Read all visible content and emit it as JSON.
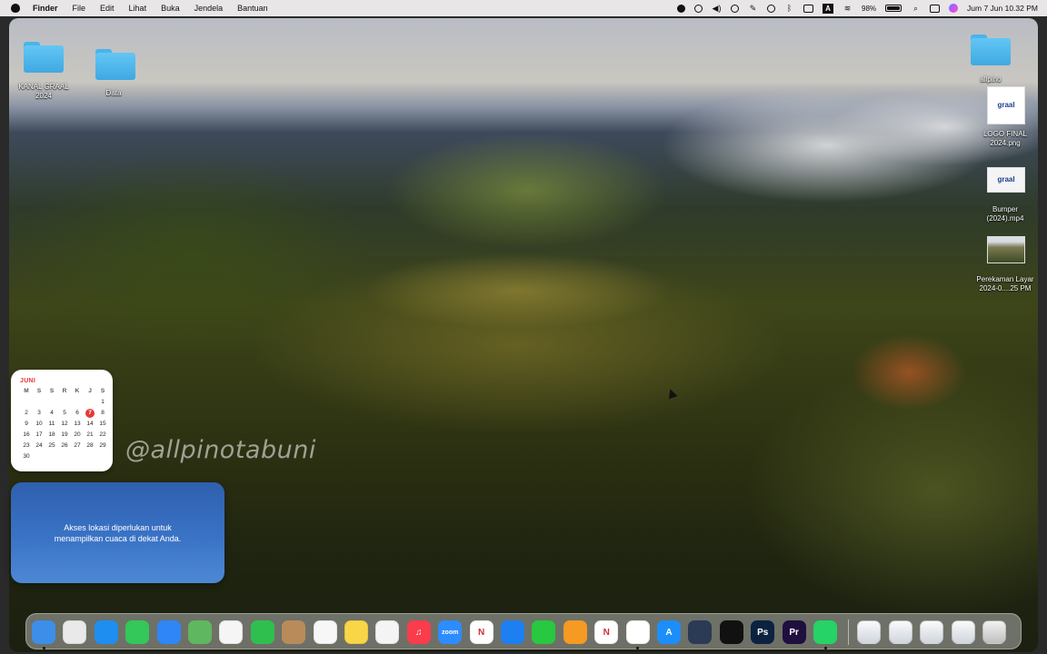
{
  "menubar": {
    "app_name": "Finder",
    "menus": [
      "File",
      "Edit",
      "Lihat",
      "Buka",
      "Jendela",
      "Bantuan"
    ],
    "battery": "98%",
    "datetime": "Jum 7 Jun  10.32 PM",
    "input_source": "A"
  },
  "desktop": {
    "left_icons": [
      {
        "label": "KANAL GRAAL\n2024",
        "icon": "folder-icon"
      },
      {
        "label": "Data",
        "icon": "folder-icon"
      }
    ],
    "right_icons": [
      {
        "label": "allpino",
        "icon": "folder-icon"
      },
      {
        "label": "LOGO FINAL\n2024.png",
        "icon": "image-file-icon",
        "thumb_text": "graal"
      },
      {
        "label": "Bumper\n(2024).mp4",
        "icon": "video-file-icon",
        "thumb_text": "graal"
      },
      {
        "label": "Perekaman Layar\n2024-0....25 PM",
        "icon": "screen-recording-icon"
      }
    ]
  },
  "calendar_widget": {
    "month": "JUNI",
    "weekdays": [
      "M",
      "S",
      "S",
      "R",
      "K",
      "J",
      "S"
    ],
    "weeks": [
      [
        "",
        "",
        "",
        "",
        "",
        "",
        "1"
      ],
      [
        "2",
        "3",
        "4",
        "5",
        "6",
        "7",
        "8"
      ],
      [
        "9",
        "10",
        "11",
        "12",
        "13",
        "14",
        "15"
      ],
      [
        "16",
        "17",
        "18",
        "19",
        "20",
        "21",
        "22"
      ],
      [
        "23",
        "24",
        "25",
        "26",
        "27",
        "28",
        "29"
      ],
      [
        "30",
        "",
        "",
        "",
        "",
        "",
        ""
      ]
    ],
    "today": "7",
    "accent_color": "#e53935"
  },
  "weather_widget": {
    "message": "Akses lokasi diperlukan untuk menampilkan cuaca di dekat Anda."
  },
  "watermark": "@allpinotabuni",
  "dock": {
    "apps": [
      {
        "name": "finder-icon",
        "color": "#3d8ee8",
        "glyph": "",
        "running": true
      },
      {
        "name": "launchpad-icon",
        "color": "#e9e9e9",
        "glyph": "",
        "running": false
      },
      {
        "name": "safari-icon",
        "color": "#1e8ef0",
        "glyph": "",
        "running": false
      },
      {
        "name": "messages-icon",
        "color": "#34c759",
        "glyph": "",
        "running": false
      },
      {
        "name": "mail-icon",
        "color": "#2f86f6",
        "glyph": "",
        "running": false
      },
      {
        "name": "maps-icon",
        "color": "#5fb85f",
        "glyph": "",
        "running": false
      },
      {
        "name": "photos-icon",
        "color": "#f5f5f5",
        "glyph": "",
        "running": false
      },
      {
        "name": "facetime-icon",
        "color": "#2fbf4f",
        "glyph": "",
        "running": false
      },
      {
        "name": "contacts-icon",
        "color": "#b98b5a",
        "glyph": "",
        "running": false
      },
      {
        "name": "reminders-icon",
        "color": "#f7f7f7",
        "glyph": "",
        "running": false
      },
      {
        "name": "notes-icon",
        "color": "#f9d648",
        "glyph": "",
        "running": false
      },
      {
        "name": "freeform-icon",
        "color": "#f4f4f4",
        "glyph": "",
        "running": false
      },
      {
        "name": "music-icon",
        "color": "#fa3c4c",
        "glyph": "♫",
        "running": false
      },
      {
        "name": "zoom-icon",
        "color": "#2d8cff",
        "glyph": "zoom",
        "running": false
      },
      {
        "name": "news-icon",
        "color": "#ffffff",
        "glyph": "N",
        "running": false
      },
      {
        "name": "keynote-icon",
        "color": "#1e7ff2",
        "glyph": "",
        "running": false
      },
      {
        "name": "numbers-icon",
        "color": "#28c840",
        "glyph": "",
        "running": false
      },
      {
        "name": "pages-icon",
        "color": "#f59a23",
        "glyph": "",
        "running": false
      },
      {
        "name": "netflix-icon",
        "color": "#ffffff",
        "glyph": "N",
        "running": false
      },
      {
        "name": "chrome-icon",
        "color": "#ffffff",
        "glyph": "",
        "running": true
      },
      {
        "name": "app-store-icon",
        "color": "#1c8ef9",
        "glyph": "A",
        "running": false
      },
      {
        "name": "xcode-icon",
        "color": "#2b3a55",
        "glyph": "",
        "running": false
      },
      {
        "name": "capcut-icon",
        "color": "#111111",
        "glyph": "",
        "running": false
      },
      {
        "name": "photoshop-icon",
        "color": "#0b2340",
        "glyph": "Ps",
        "running": false
      },
      {
        "name": "premiere-pro-icon",
        "color": "#1f0f3f",
        "glyph": "Pr",
        "running": false
      },
      {
        "name": "whatsapp-icon",
        "color": "#25d366",
        "glyph": "",
        "running": true
      }
    ],
    "stack_items": [
      {
        "name": "downloads-stack-icon"
      },
      {
        "name": "screenshot-stack-icon"
      },
      {
        "name": "documents-stack-icon"
      },
      {
        "name": "desktop-stack-icon"
      },
      {
        "name": "trash-icon"
      }
    ]
  }
}
